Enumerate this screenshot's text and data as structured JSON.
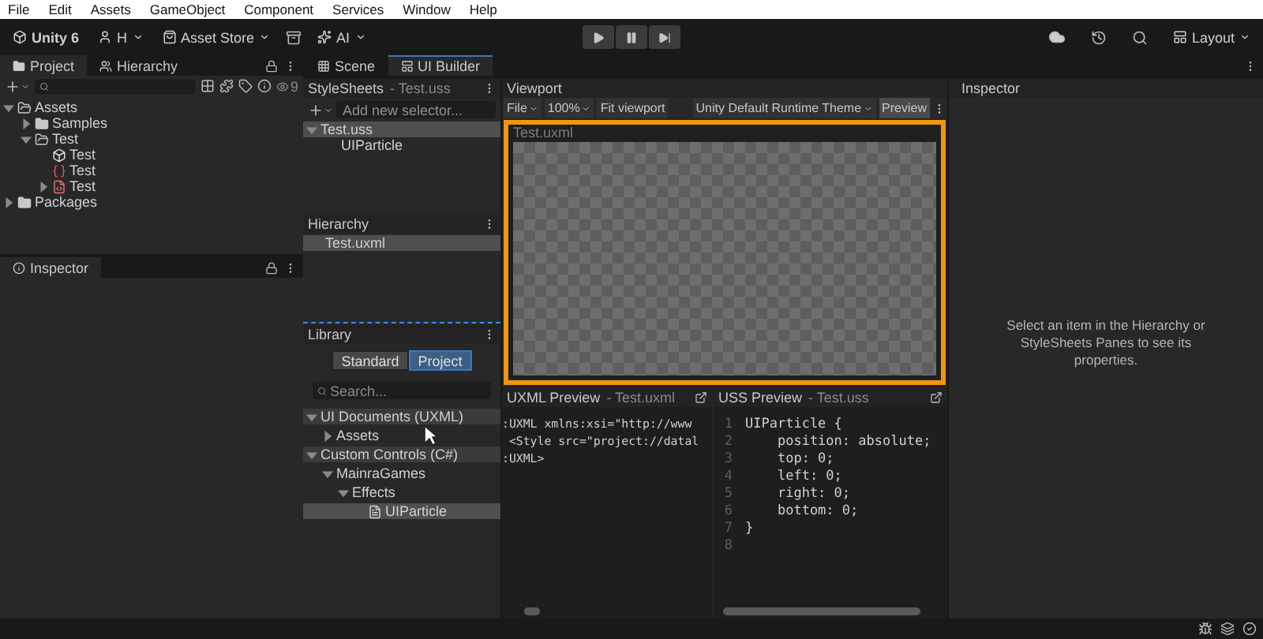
{
  "menu_bar": [
    "File",
    "Edit",
    "Assets",
    "GameObject",
    "Component",
    "Services",
    "Window",
    "Help"
  ],
  "toolbar": {
    "account": "Unity 6",
    "user": "H",
    "asset_store": "Asset Store",
    "ai": "AI",
    "layout": "Layout"
  },
  "project_panel": {
    "tabs": [
      {
        "label": "Project",
        "selected": true
      },
      {
        "label": "Hierarchy",
        "selected": false
      }
    ],
    "hidden_count": "9",
    "tree": [
      {
        "label": "Assets",
        "kind": "folder",
        "expanded": true,
        "children": [
          {
            "label": "Samples",
            "kind": "folder",
            "expanded": false
          },
          {
            "label": "Test",
            "kind": "folder",
            "expanded": true,
            "children": [
              {
                "label": "Test",
                "kind": "prefab"
              },
              {
                "label": "Test",
                "kind": "stylesheet"
              },
              {
                "label": "Test",
                "kind": "document",
                "expanded": false
              }
            ]
          }
        ]
      },
      {
        "label": "Packages",
        "kind": "folder",
        "expanded": false
      }
    ]
  },
  "inspector_panel": {
    "tab": "Inspector"
  },
  "editor_tabs": [
    {
      "label": "Scene",
      "selected": false
    },
    {
      "label": "UI Builder",
      "selected": true
    }
  ],
  "stylesheets": {
    "title": "StyleSheets",
    "subtitle": "- Test.uss",
    "selector_placeholder": "Add new selector...",
    "items": [
      {
        "label": "Test.uss",
        "selected": true,
        "expanded": true,
        "children": [
          {
            "label": "UIParticle",
            "selected": false
          }
        ]
      }
    ]
  },
  "hierarchy": {
    "title": "Hierarchy",
    "items": [
      {
        "label": "Test.uxml",
        "selected": true
      }
    ]
  },
  "library": {
    "title": "Library",
    "toggle": [
      {
        "label": "Standard",
        "selected": false
      },
      {
        "label": "Project",
        "selected": true
      }
    ],
    "search_placeholder": "Search...",
    "tree": [
      {
        "label": "UI Documents (UXML)",
        "kind": "category",
        "selected": false,
        "expanded": true,
        "children": [
          {
            "label": "Assets",
            "selected": false,
            "expanded": false
          }
        ]
      },
      {
        "label": "Custom Controls (C#)",
        "kind": "category",
        "selected": false,
        "expanded": true,
        "children": [
          {
            "label": "MainraGames",
            "selected": false,
            "expanded": true,
            "children": [
              {
                "label": "Effects",
                "selected": false,
                "expanded": true,
                "children": [
                  {
                    "label": "UIParticle",
                    "kind": "control",
                    "selected": true
                  }
                ]
              }
            ]
          }
        ]
      }
    ]
  },
  "viewport": {
    "title": "Viewport",
    "file": "File",
    "zoom": "100%",
    "fit": "Fit viewport",
    "theme": "Unity Default Runtime Theme",
    "preview": "Preview",
    "canvas_label": "Test.uxml"
  },
  "uxml_preview": {
    "title": "UXML Preview",
    "subtitle": "- Test.uxml",
    "lines": [
      ":UXML xmlns:xsi=\"http://www",
      " <Style src=\"project://datal",
      ":UXML>"
    ]
  },
  "uss_preview": {
    "title": "USS Preview",
    "subtitle": "- Test.uss",
    "lines": [
      {
        "number": "1",
        "text": "UIParticle {"
      },
      {
        "number": "2",
        "text": "    position: absolute;"
      },
      {
        "number": "3",
        "text": "    top: 0;"
      },
      {
        "number": "4",
        "text": "    left: 0;"
      },
      {
        "number": "5",
        "text": "    right: 0;"
      },
      {
        "number": "6",
        "text": "    bottom: 0;"
      },
      {
        "number": "7",
        "text": "}"
      },
      {
        "number": "8"
      }
    ]
  },
  "inspector": {
    "title": "Inspector",
    "message": "Select an item in the Hierarchy or StyleSheets Panes to see its properties."
  }
}
